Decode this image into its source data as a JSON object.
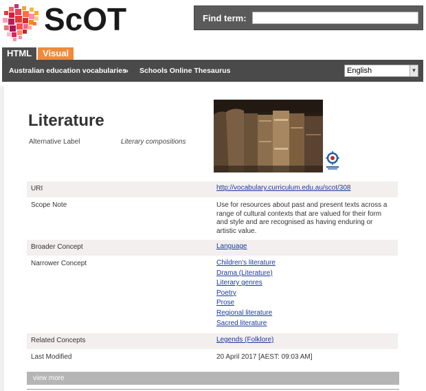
{
  "logo": {
    "text": "ScOT"
  },
  "search": {
    "label": "Find term:",
    "value": "",
    "placeholder": ""
  },
  "tabs": [
    {
      "label": "HTML"
    },
    {
      "label": "Visual"
    }
  ],
  "breadcrumb": {
    "items": [
      "Australian education vocabularies",
      "»",
      "Schools Online Thesaurus"
    ]
  },
  "language": {
    "selected": "English"
  },
  "concept": {
    "title": "Literature",
    "alt_label_key": "Alternative Label",
    "alt_label_value": "Literary compositions"
  },
  "rows": {
    "uri": {
      "label": "URI",
      "value": "http://vocabulary.curriculum.edu.au/scot/308"
    },
    "scope": {
      "label": "Scope Note",
      "lines": [
        "Use for resources about past and present texts across a",
        "range of cultural contexts that are valued for their form",
        "and style and are recognised as having enduring or",
        "artistic value."
      ]
    },
    "broader": {
      "label": "Broader Concept",
      "value": "Language"
    },
    "narrower": {
      "label": "Narrower Concept",
      "items": [
        "Children's literature",
        "Drama (Literature)",
        "Literary genres",
        "Poetry",
        "Prose",
        "Regional literature",
        "Sacred literature"
      ]
    },
    "related": {
      "label": "Related Concepts",
      "value": "Legends (Folklore)"
    },
    "modified": {
      "label": "Last Modified",
      "value": "20 April 2017 [AEST: 09:03 AM]"
    }
  },
  "view_more": "view more",
  "colors": {
    "accent": "#f08a3a",
    "nav": "#4a4a4a",
    "link": "#1a3a9a",
    "shade": "#f2efee"
  }
}
